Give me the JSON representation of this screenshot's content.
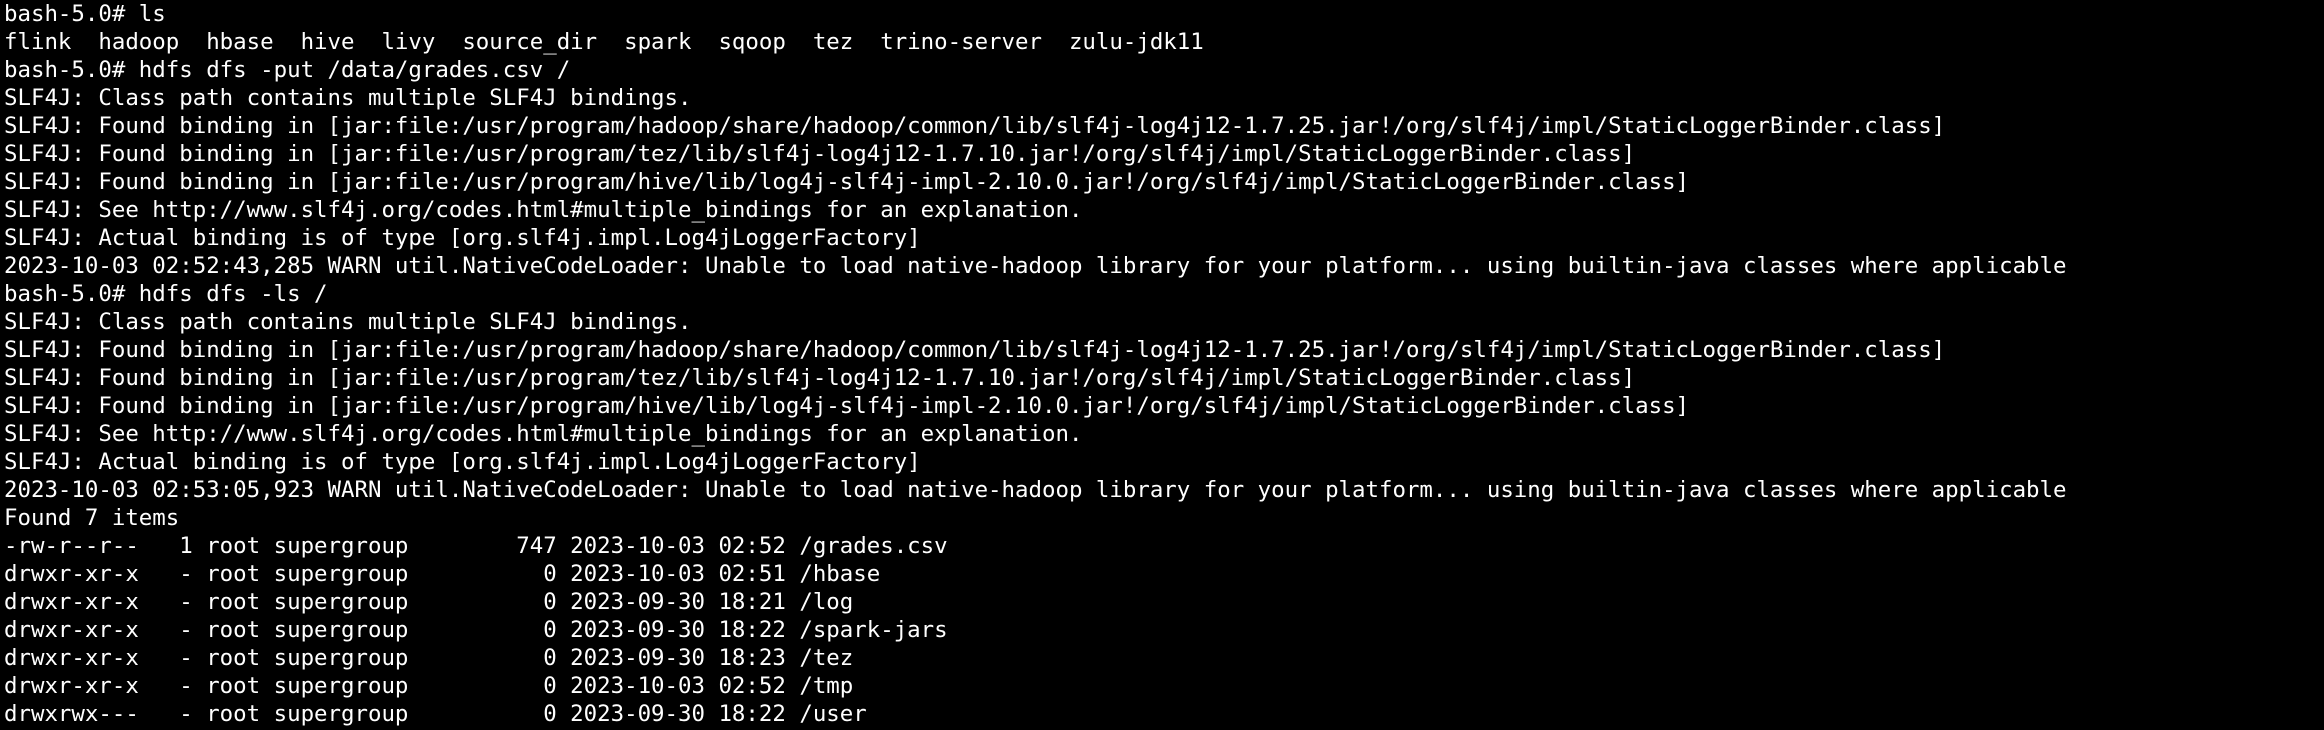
{
  "terminal": {
    "lines": [
      "bash-5.0# ls",
      "flink  hadoop  hbase  hive  livy  source_dir  spark  sqoop  tez  trino-server  zulu-jdk11",
      "bash-5.0# hdfs dfs -put /data/grades.csv /",
      "SLF4J: Class path contains multiple SLF4J bindings.",
      "SLF4J: Found binding in [jar:file:/usr/program/hadoop/share/hadoop/common/lib/slf4j-log4j12-1.7.25.jar!/org/slf4j/impl/StaticLoggerBinder.class]",
      "SLF4J: Found binding in [jar:file:/usr/program/tez/lib/slf4j-log4j12-1.7.10.jar!/org/slf4j/impl/StaticLoggerBinder.class]",
      "SLF4J: Found binding in [jar:file:/usr/program/hive/lib/log4j-slf4j-impl-2.10.0.jar!/org/slf4j/impl/StaticLoggerBinder.class]",
      "SLF4J: See http://www.slf4j.org/codes.html#multiple_bindings for an explanation.",
      "SLF4J: Actual binding is of type [org.slf4j.impl.Log4jLoggerFactory]",
      "2023-10-03 02:52:43,285 WARN util.NativeCodeLoader: Unable to load native-hadoop library for your platform... using builtin-java classes where applicable",
      "bash-5.0# hdfs dfs -ls /",
      "SLF4J: Class path contains multiple SLF4J bindings.",
      "SLF4J: Found binding in [jar:file:/usr/program/hadoop/share/hadoop/common/lib/slf4j-log4j12-1.7.25.jar!/org/slf4j/impl/StaticLoggerBinder.class]",
      "SLF4J: Found binding in [jar:file:/usr/program/tez/lib/slf4j-log4j12-1.7.10.jar!/org/slf4j/impl/StaticLoggerBinder.class]",
      "SLF4J: Found binding in [jar:file:/usr/program/hive/lib/log4j-slf4j-impl-2.10.0.jar!/org/slf4j/impl/StaticLoggerBinder.class]",
      "SLF4J: See http://www.slf4j.org/codes.html#multiple_bindings for an explanation.",
      "SLF4J: Actual binding is of type [org.slf4j.impl.Log4jLoggerFactory]",
      "2023-10-03 02:53:05,923 WARN util.NativeCodeLoader: Unable to load native-hadoop library for your platform... using builtin-java classes where applicable",
      "Found 7 items",
      "-rw-r--r--   1 root supergroup        747 2023-10-03 02:52 /grades.csv",
      "drwxr-xr-x   - root supergroup          0 2023-10-03 02:51 /hbase",
      "drwxr-xr-x   - root supergroup          0 2023-09-30 18:21 /log",
      "drwxr-xr-x   - root supergroup          0 2023-09-30 18:22 /spark-jars",
      "drwxr-xr-x   - root supergroup          0 2023-09-30 18:23 /tez",
      "drwxr-xr-x   - root supergroup          0 2023-10-03 02:52 /tmp",
      "drwxrwx---   - root supergroup          0 2023-09-30 18:22 /user"
    ]
  },
  "colors": {
    "background": "#000000",
    "foreground": "#ffffff"
  }
}
